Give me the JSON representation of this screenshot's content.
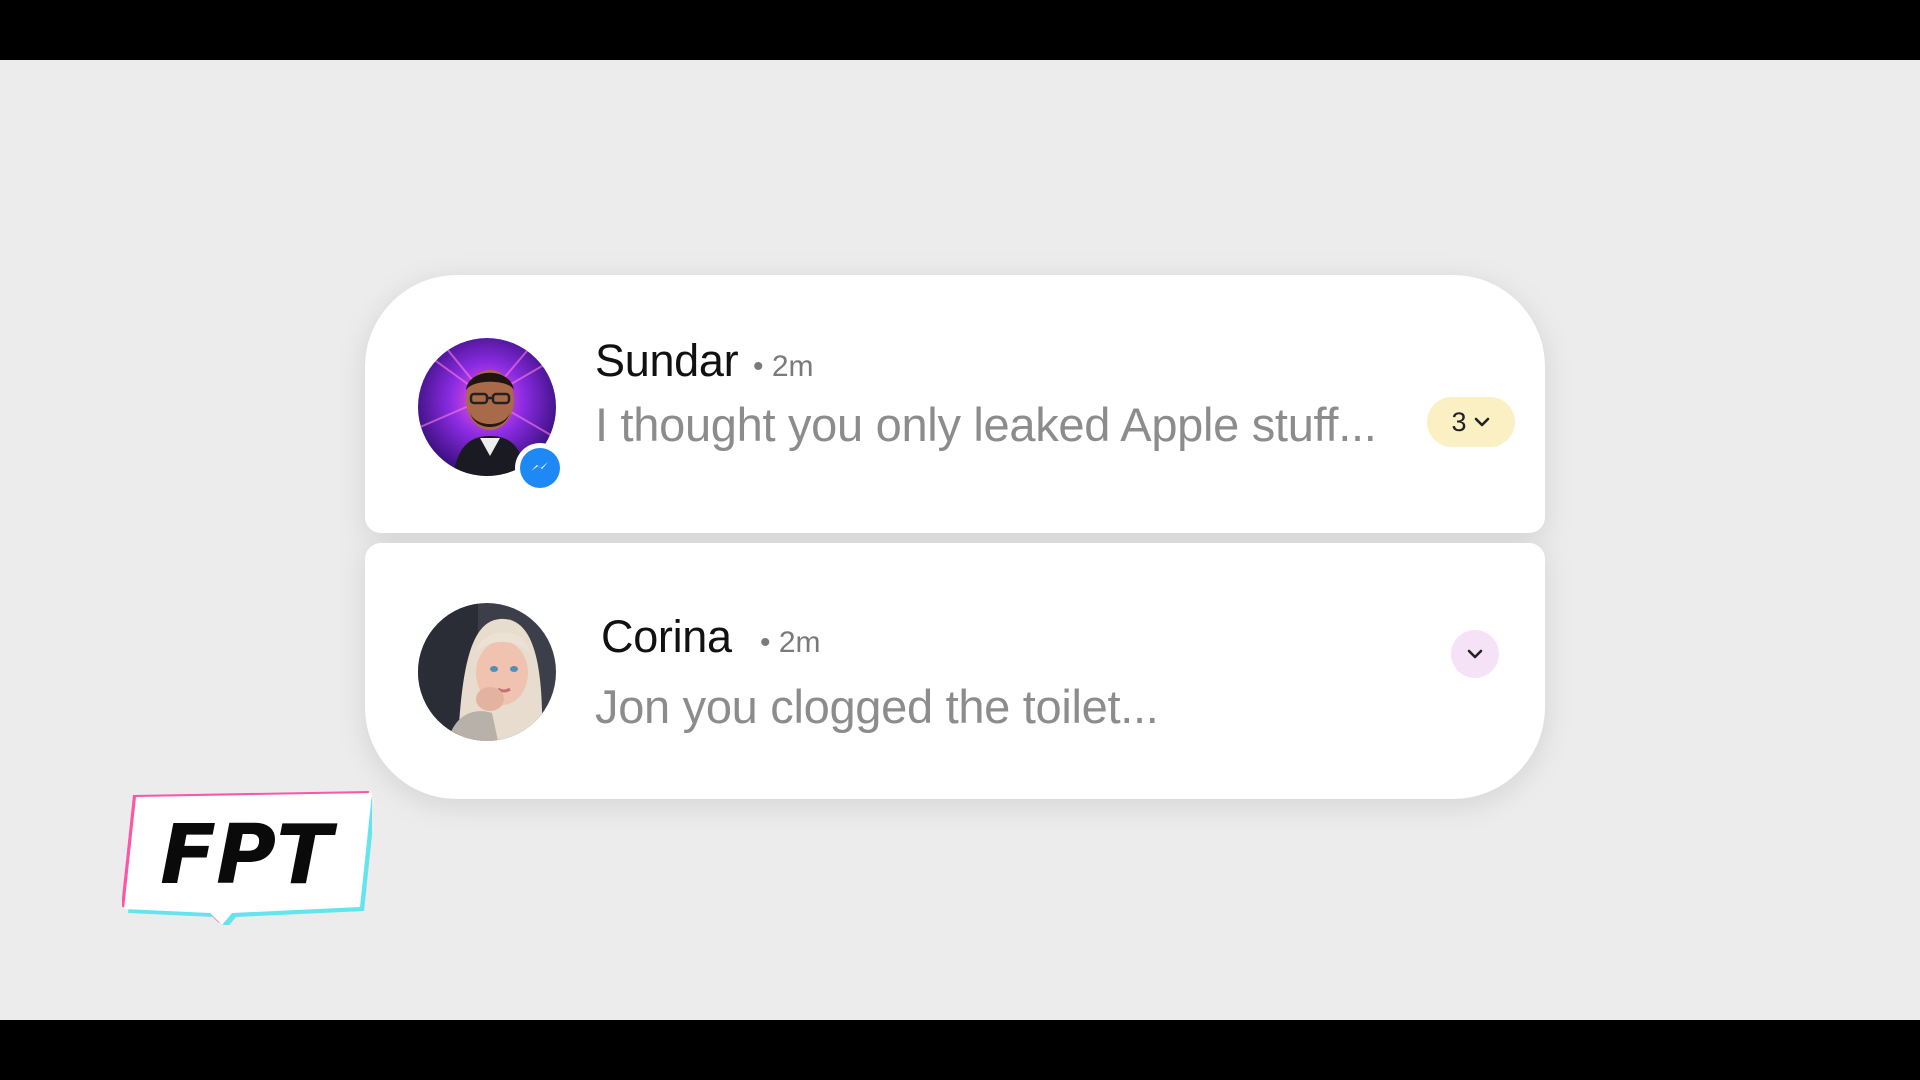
{
  "notifications": [
    {
      "sender": "Sundar",
      "time": "• 2m",
      "message": "I thought you only leaked Apple stuff...",
      "count": "3",
      "app_icon": "messenger-icon",
      "count_pill_color": "#fbefc4"
    },
    {
      "sender": "Corina",
      "time": "• 2m",
      "message": "Jon you clogged the toilet...",
      "expand_button_color": "#f6e2f7"
    }
  ],
  "watermark": {
    "text": "FPT"
  },
  "colors": {
    "background": "#ececec",
    "card": "#ffffff",
    "messenger_blue": "#1e88f5",
    "name_text": "#111111",
    "message_text": "#8c8c8c"
  }
}
